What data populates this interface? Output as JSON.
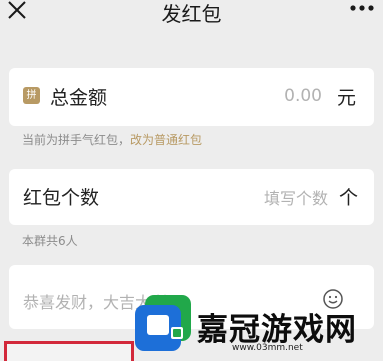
{
  "header": {
    "title": "发红包"
  },
  "amount": {
    "badge": "拼",
    "label": "总金额",
    "value": "0.00",
    "unit": "元"
  },
  "hint1": {
    "prefix": "当前为拼手气红包，",
    "link": "改为普通红包"
  },
  "count": {
    "label": "红包个数",
    "placeholder": "填写个数",
    "unit": "个"
  },
  "hint2": "本群共6人",
  "greeting": {
    "text": "恭喜发财，大吉大利"
  },
  "watermark": {
    "text": "嘉冠游戏网",
    "url": "www.03mm.net"
  },
  "colors": {
    "background": "#ededed",
    "accent": "#b89a64",
    "red": "#d2283a",
    "placeholder": "#b2b2b2"
  }
}
